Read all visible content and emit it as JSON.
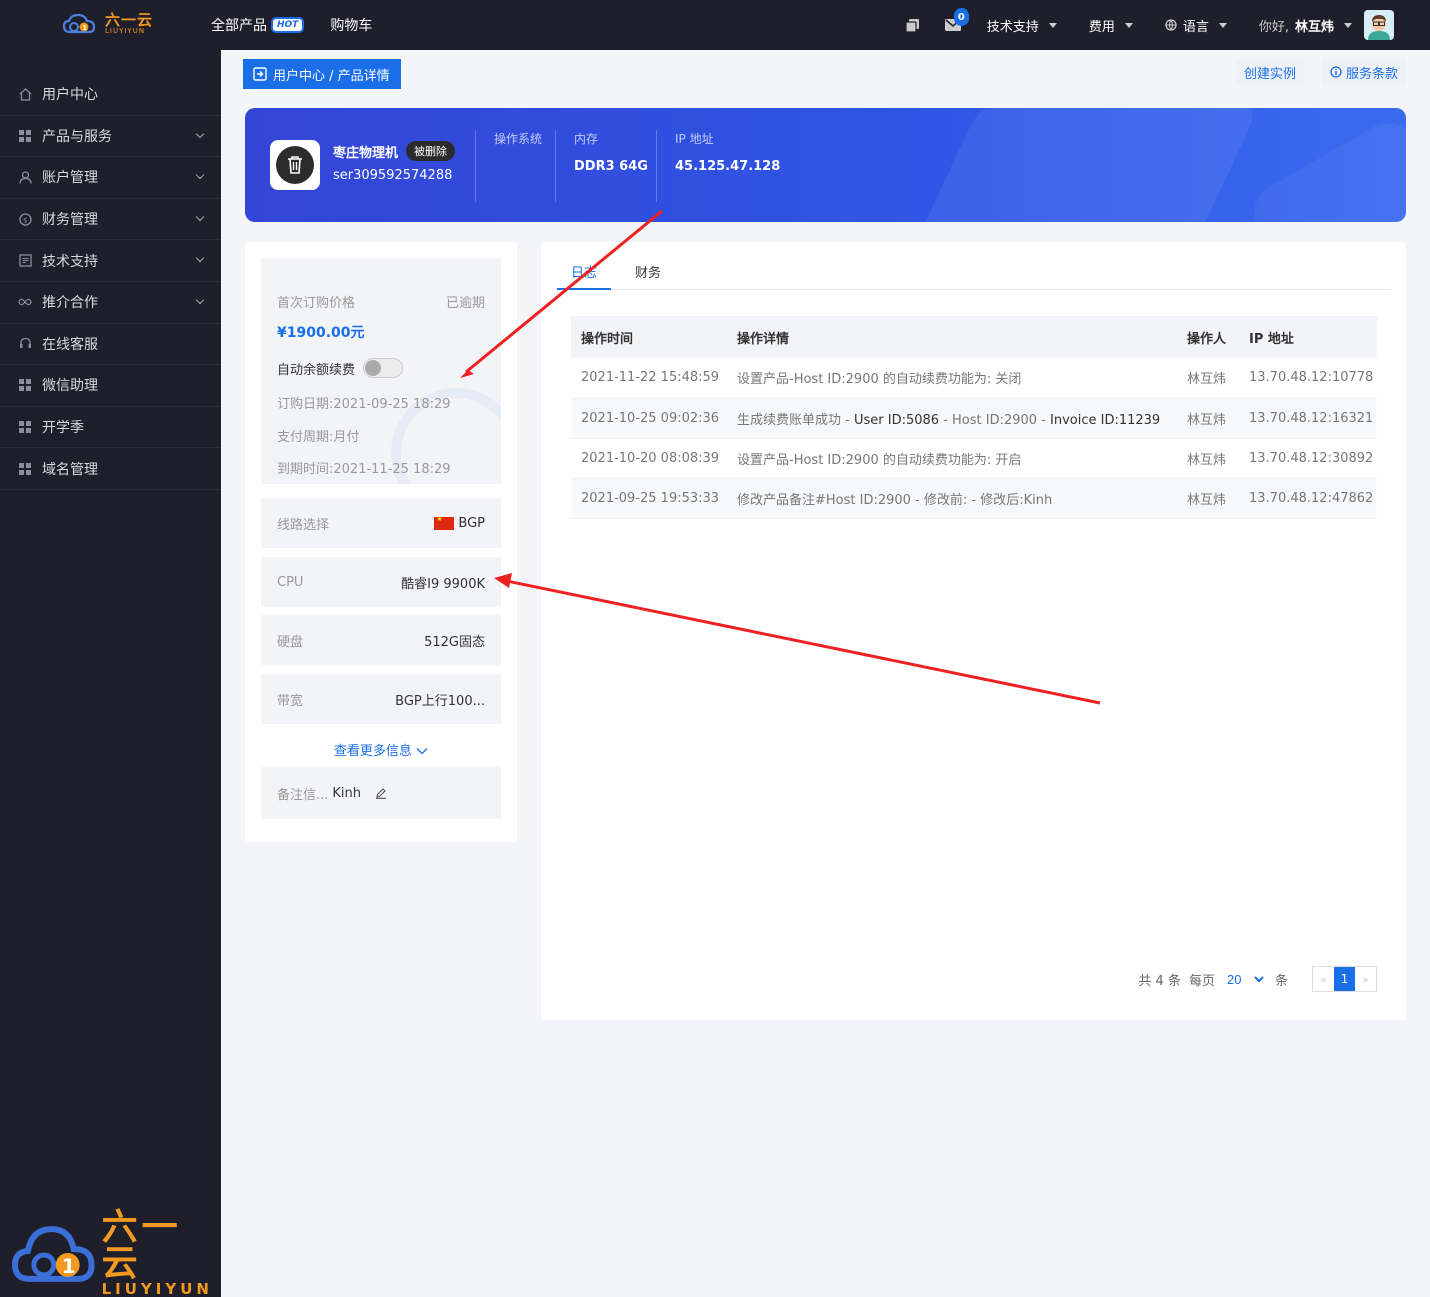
{
  "topbar": {
    "logo_cn": "六一云",
    "logo_en": "LIUYIYUN",
    "all_products": "全部产品",
    "hot_badge": "HOT",
    "cart": "购物车",
    "message_count": "0",
    "tech_support": "技术支持",
    "fees": "费用",
    "language": "语言",
    "greeting": "你好,",
    "username": "林互炜"
  },
  "sidebar": {
    "items": [
      {
        "label": "用户中心",
        "icon": "home-icon"
      },
      {
        "label": "产品与服务",
        "icon": "grid-icon"
      },
      {
        "label": "账户管理",
        "icon": "user-icon"
      },
      {
        "label": "财务管理",
        "icon": "money-icon"
      },
      {
        "label": "技术支持",
        "icon": "document-icon"
      },
      {
        "label": "推介合作",
        "icon": "infinity-icon"
      },
      {
        "label": "在线客服",
        "icon": "headset-icon"
      },
      {
        "label": "微信助理",
        "icon": "grid-icon"
      },
      {
        "label": "开学季",
        "icon": "grid-icon"
      },
      {
        "label": "域名管理",
        "icon": "grid-icon"
      }
    ],
    "logo_cn": "六一云",
    "logo_en": "LIUYIYUN"
  },
  "breadcrumb": "用户中心 / 产品详情",
  "actions": {
    "create_instance": "创建实例",
    "service_terms": "服务条款"
  },
  "product": {
    "name": "枣庄物理机",
    "status": "被删除",
    "serial": "ser309592574288",
    "os_label": "操作系统",
    "os_value": "",
    "memory_label": "内存",
    "memory_value": "DDR3 64G",
    "ip_label": "IP 地址",
    "ip_value": "45.125.47.128"
  },
  "billing": {
    "first_price_label": "首次订购价格",
    "expired": "已逾期",
    "price": "¥1900.00元",
    "auto_renew_label": "自动余额续费",
    "auto_renew_on": false,
    "order_date": "订购日期:2021-09-25 18:29",
    "pay_cycle": "支付周期:月付",
    "expire_date": "到期时间:2021-11-25 18:29"
  },
  "specs": [
    {
      "key": "线路选择",
      "value": "BGP",
      "flag": true
    },
    {
      "key": "CPU",
      "value": "酷睿I9 9900K"
    },
    {
      "key": "硬盘",
      "value": "512G固态"
    },
    {
      "key": "带宽",
      "value": "BGP上行100..."
    }
  ],
  "more_info": "查看更多信息",
  "note": {
    "label": "备注信...",
    "value": "Kinh"
  },
  "tabs": [
    "日志",
    "财务"
  ],
  "log_table": {
    "headers": [
      "操作时间",
      "操作详情",
      "操作人",
      "IP 地址"
    ],
    "rows": [
      {
        "time": "2021-11-22 15:48:59",
        "detail": "设置产品-Host ID:2900 的自动续费功能为: 关闭",
        "user": "林互炜",
        "ip": "13.70.48.12:10778"
      },
      {
        "time": "2021-10-25 09:02:36",
        "detail_a": "生成续费账单成功 - ",
        "detail_b": "User ID:5086",
        "detail_c": " - Host ID:2900 - ",
        "detail_d": "Invoice ID:11239",
        "user": "林互炜",
        "ip": "13.70.48.12:16321"
      },
      {
        "time": "2021-10-20 08:08:39",
        "detail": "设置产品-Host ID:2900 的自动续费功能为: 开启",
        "user": "林互炜",
        "ip": "13.70.48.12:30892"
      },
      {
        "time": "2021-09-25 19:53:33",
        "detail": "修改产品备注#Host ID:2900 - 修改前: - 修改后:Kinh",
        "user": "林互炜",
        "ip": "13.70.48.12:47862"
      }
    ]
  },
  "pager": {
    "total": "共 4 条",
    "per_page_label": "每页",
    "per_page": "20",
    "unit": "条",
    "prev": "«",
    "current": "1",
    "next": "»"
  },
  "colors": {
    "accent": "#1a6fe8",
    "dark_bg": "#1e1f2b",
    "brand_orange": "#f29a1f",
    "annotation_red": "#ee2222"
  }
}
